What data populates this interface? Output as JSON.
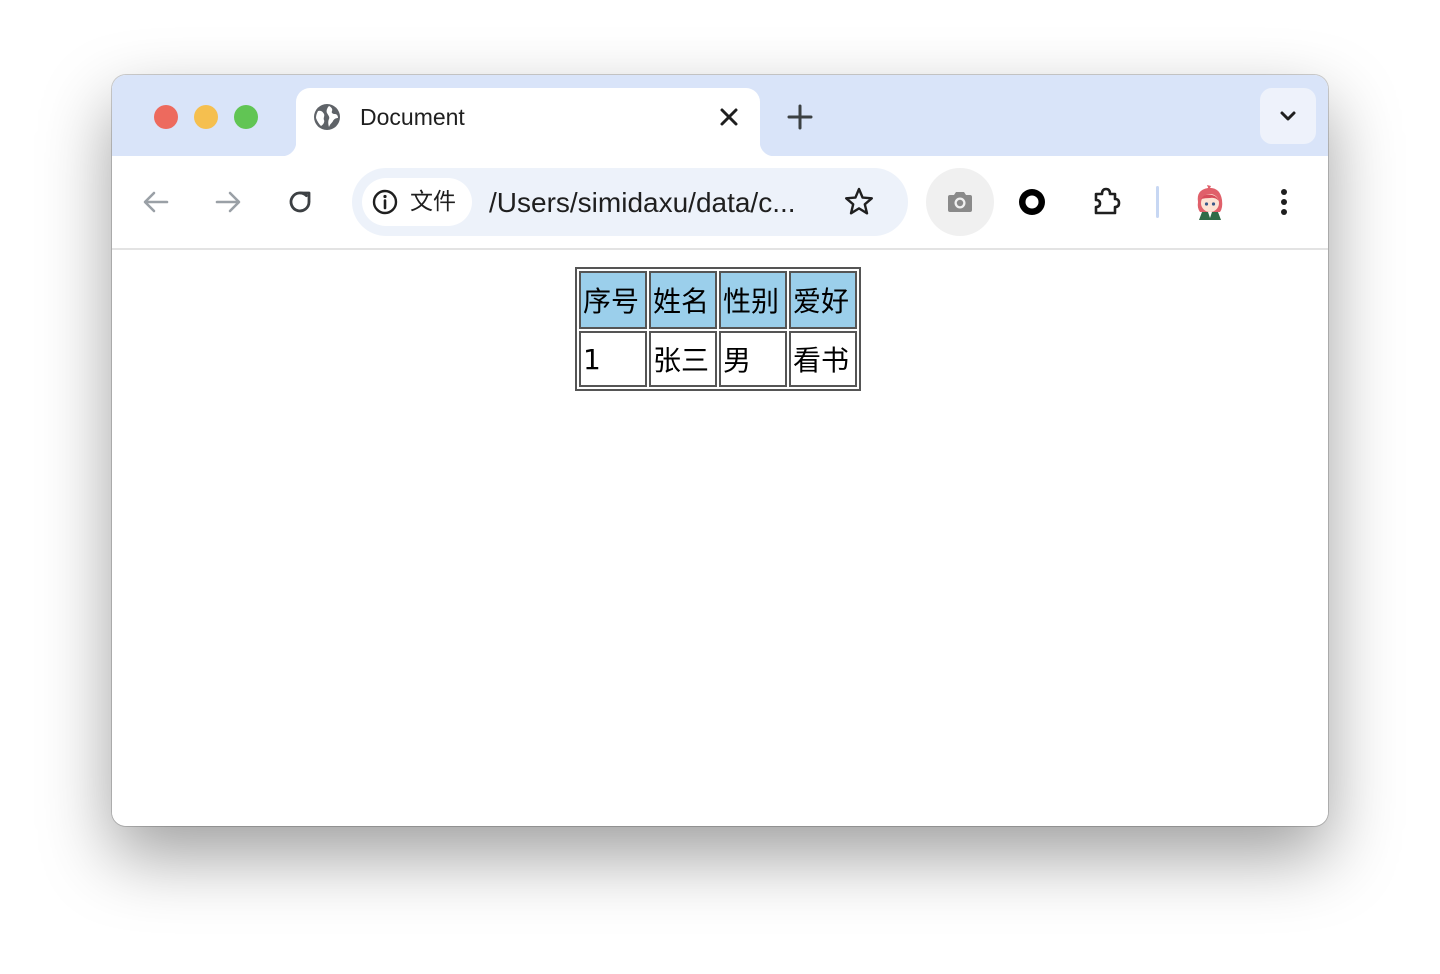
{
  "browser": {
    "tab": {
      "title": "Document",
      "icon": "globe-icon"
    },
    "new_tab_icon": "plus-icon",
    "tab_search_icon": "chevron-down-icon",
    "nav": {
      "back_icon": "arrow-left-icon",
      "forward_icon": "arrow-right-icon",
      "reload_icon": "reload-icon"
    },
    "omnibox": {
      "chip_label": "文件",
      "chip_icon": "info-icon",
      "url": "/Users/simidaxu/data/c...",
      "bookmark_icon": "star-icon"
    },
    "toolbar_icons": [
      "camera-icon",
      "record-icon",
      "puzzle-icon",
      "avatar",
      "more-vert-icon"
    ],
    "colors": {
      "tabstrip": "#d9e4f9",
      "omnibox": "#edf2fa",
      "close": "#ed6a5e",
      "minimize": "#f5bf4f",
      "maximize": "#61c554"
    }
  },
  "page": {
    "table": {
      "headers": [
        "序号",
        "姓名",
        "性别",
        "爱好"
      ],
      "rows": [
        [
          "1",
          "张三",
          "男",
          "看书"
        ]
      ],
      "header_bg": "#9bcfeb"
    }
  }
}
